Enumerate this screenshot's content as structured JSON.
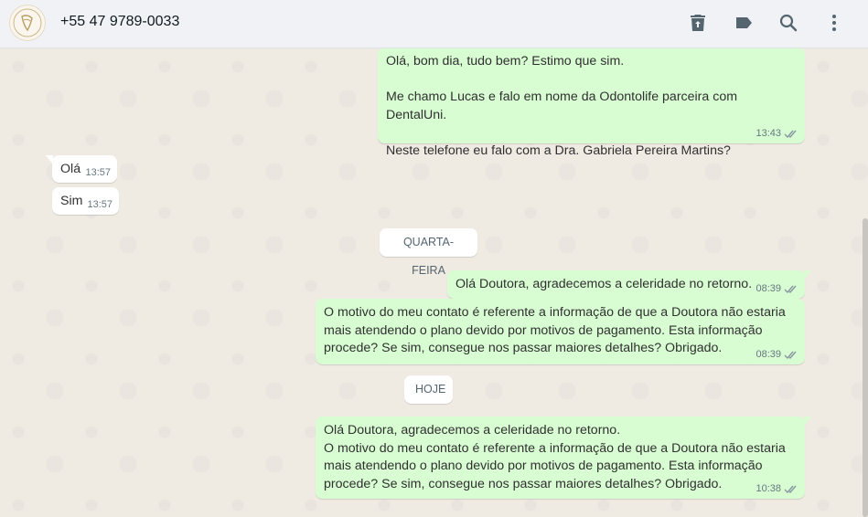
{
  "header": {
    "contact_name": "+55 47 9789-0033",
    "icons": [
      "delete-icon",
      "label-icon",
      "search-icon",
      "menu-icon"
    ]
  },
  "messages": [
    {
      "direction": "out",
      "text": "Olá, bom dia, tudo bem? Estimo que sim.\n\nMe chamo Lucas e falo em nome da Odontolife parceira com DentalUni.\n\nNeste telefone eu falo com a Dra. Gabriela Pereira Martins?",
      "time": "13:43",
      "status": "read"
    },
    {
      "direction": "in",
      "text": "Olá",
      "time": "13:57"
    },
    {
      "direction": "in",
      "text": "Sim",
      "time": "13:57"
    },
    {
      "direction": "out",
      "text": "Olá Doutora, agradecemos a celeridade no retorno.",
      "time": "08:39",
      "status": "read"
    },
    {
      "direction": "out",
      "text": "O motivo do meu contato é referente a informação de que a Doutora não estaria mais atendendo o plano devido por motivos de pagamento. Esta informação procede? Se sim, consegue nos passar maiores detalhes? Obrigado.",
      "time": "08:39",
      "status": "read"
    },
    {
      "direction": "out",
      "text": "Olá Doutora, agradecemos a celeridade no retorno.\nO motivo do meu contato é referente a informação de que a Doutora não estaria mais atendendo o plano devido por motivos de pagamento. Esta informação procede? Se sim, consegue nos passar maiores detalhes? Obrigado.",
      "time": "10:38",
      "status": "read"
    }
  ],
  "separators": [
    "QUARTA-FEIRA",
    "HOJE"
  ],
  "colors": {
    "outgoing_bubble": "#d9fdd3",
    "incoming_bubble": "#ffffff",
    "chat_background": "#efeae2",
    "header_background": "#f0f2f5",
    "read_ticks": "#8696a0"
  }
}
